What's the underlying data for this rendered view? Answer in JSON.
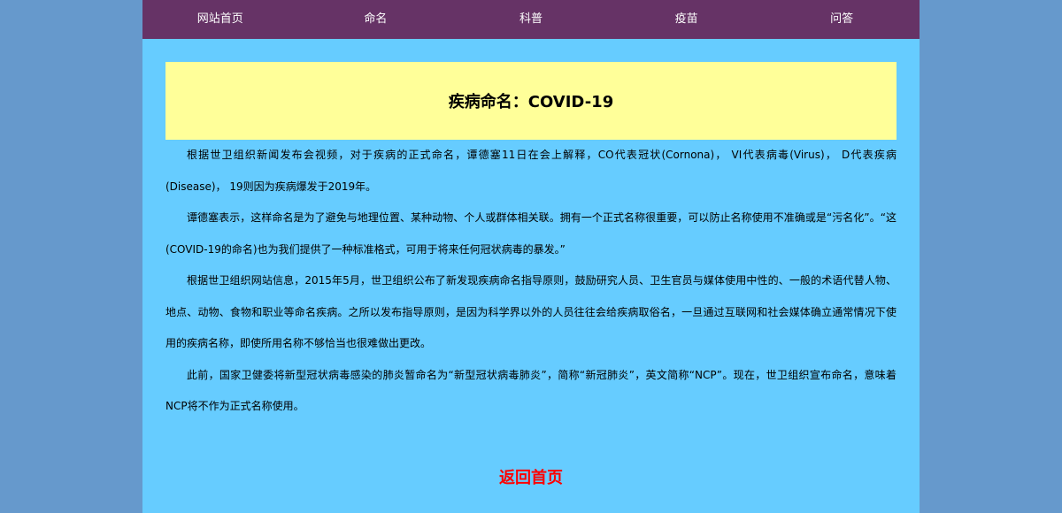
{
  "nav": {
    "items": [
      {
        "label": "网站首页"
      },
      {
        "label": "命名"
      },
      {
        "label": "科普"
      },
      {
        "label": "疫苗"
      },
      {
        "label": "问答"
      }
    ]
  },
  "article": {
    "title": "疾病命名：COVID-19",
    "paragraphs": [
      "根据世卫组织新闻发布会视频，对于疾病的正式命名，谭德塞11日在会上解释，CO代表冠状(Cornona)， VI代表病毒(Virus)， D代表疾病(Disease)， 19则因为疾病爆发于2019年。",
      "谭德塞表示，这样命名是为了避免与地理位置、某种动物、个人或群体相关联。拥有一个正式名称很重要，可以防止名称使用不准确或是“污名化”。“这(COVID-19的命名)也为我们提供了一种标准格式，可用于将来任何冠状病毒的暴发。”",
      "根据世卫组织网站信息，2015年5月，世卫组织公布了新发现疾病命名指导原则，鼓励研究人员、卫生官员与媒体使用中性的、一般的术语代替人物、地点、动物、食物和职业等命名疾病。之所以发布指导原则，是因为科学界以外的人员往往会给疾病取俗名，一旦通过互联网和社会媒体确立通常情况下使用的疾病名称，即使所用名称不够恰当也很难做出更改。",
      "此前，国家卫健委将新型冠状病毒感染的肺炎暂命名为“新型冠状病毒肺炎”，简称“新冠肺炎”，英文简称“NCP”。现在，世卫组织宣布命名，意味着NCP将不作为正式名称使用。"
    ]
  },
  "footer": {
    "back_label": "返回首页"
  },
  "colors": {
    "background": "#6699cc",
    "page": "#66ccff",
    "nav": "#663366",
    "title_box": "#ffff99",
    "back_link": "#ff0000"
  }
}
